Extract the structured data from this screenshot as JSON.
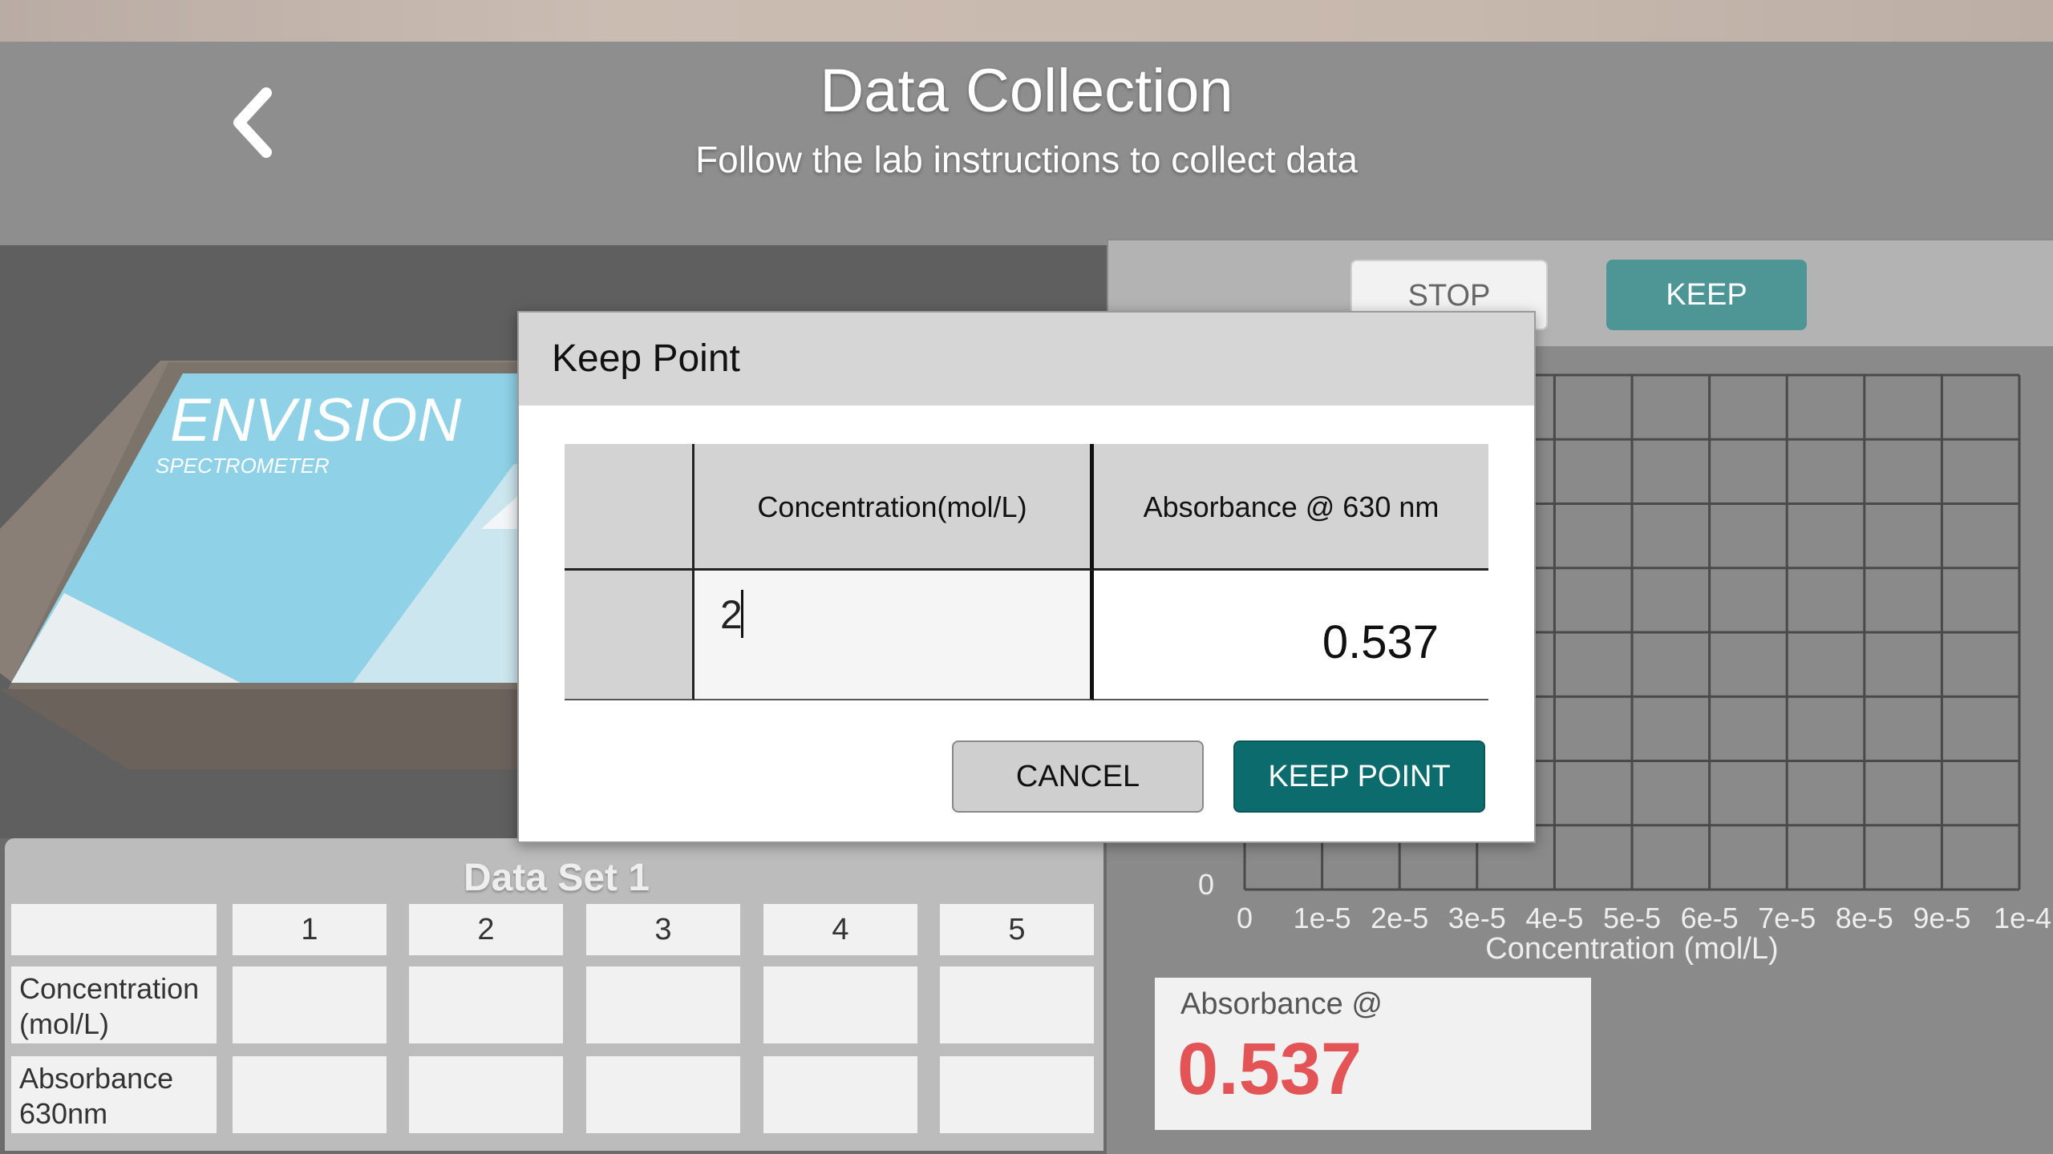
{
  "header": {
    "title": "Data Collection",
    "subtitle": "Follow the lab instructions to collect data",
    "back_icon": "chevron-left-icon"
  },
  "device": {
    "brand": "ENVISION",
    "model": "SPECTROMETER"
  },
  "data_set": {
    "title": "Data Set 1",
    "columns": [
      "1",
      "2",
      "3",
      "4",
      "5"
    ],
    "rows": [
      {
        "label": "Concentration (mol/L)",
        "values": [
          "",
          "",
          "",
          "",
          ""
        ]
      },
      {
        "label": "Absorbance 630nm",
        "values": [
          "",
          "",
          "",
          "",
          ""
        ]
      }
    ]
  },
  "graph_panel": {
    "stop_label": "STOP",
    "keep_label": "KEEP",
    "absorbance_label": "Absorbance @",
    "absorbance_value": "0.537"
  },
  "chart_data": {
    "type": "scatter",
    "xlabel": "Concentration (mol/L)",
    "ylabel": "",
    "x_ticks": [
      "0",
      "1e-5",
      "2e-5",
      "3e-5",
      "4e-5",
      "5e-5",
      "6e-5",
      "7e-5",
      "8e-5",
      "9e-5",
      "1e-4"
    ],
    "y_tick_min_label": "0",
    "xlim": [
      0,
      0.0001
    ],
    "grid": true,
    "series": []
  },
  "dialog": {
    "title": "Keep Point",
    "col_concentration": "Concentration(mol/L)",
    "col_absorbance": "Absorbance @ 630 nm",
    "concentration_value": "2",
    "absorbance_value": "0.537",
    "cancel_label": "CANCEL",
    "keep_point_label": "KEEP POINT"
  },
  "colors": {
    "teal_primary": "#0c6b6d",
    "teal_light": "#4e9595",
    "absorbance_red": "#e25456"
  }
}
